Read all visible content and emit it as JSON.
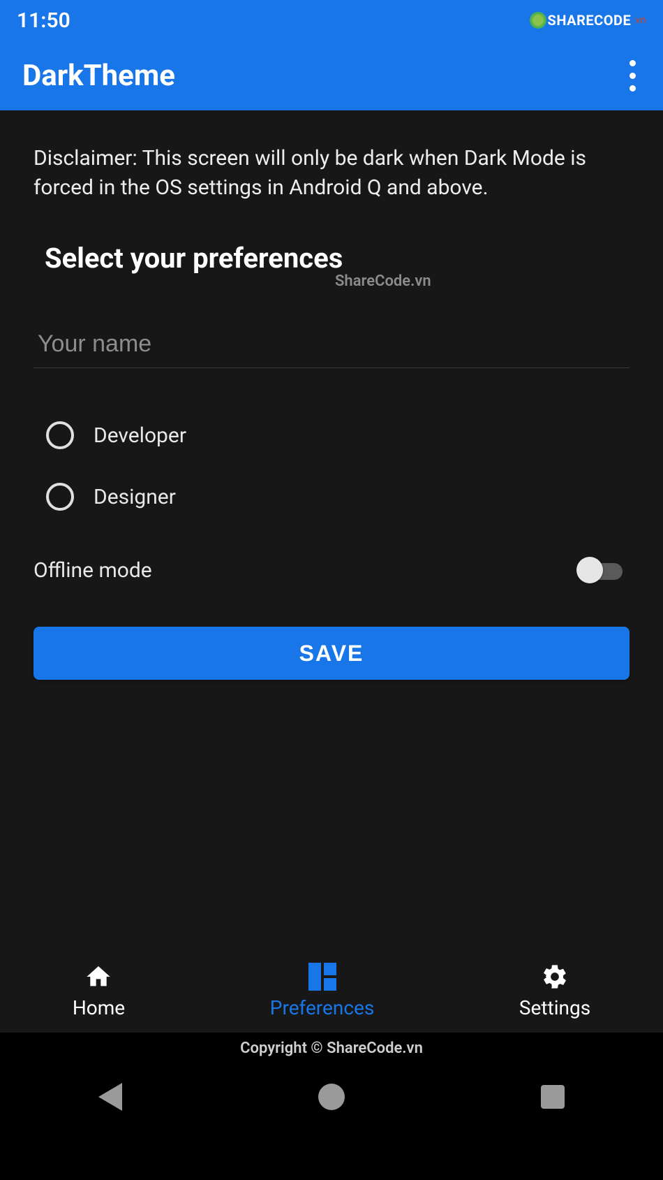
{
  "statusbar": {
    "time": "11:50",
    "brand": "SHARECODE",
    "brand_suffix": ".vn"
  },
  "appbar": {
    "title": "DarkTheme"
  },
  "content": {
    "disclaimer": "Disclaimer: This screen will only be dark when Dark Mode is forced in the OS settings in Android Q and above.",
    "heading": "Select your preferences",
    "watermark_center": "ShareCode.vn",
    "name_placeholder": "Your name",
    "name_value": "",
    "radios": [
      {
        "label": "Developer",
        "checked": false
      },
      {
        "label": "Designer",
        "checked": false
      }
    ],
    "switch_label": "Offline mode",
    "switch_on": false,
    "save_label": "SAVE"
  },
  "bottomnav": {
    "items": [
      {
        "label": "Home",
        "icon": "home-icon",
        "active": false
      },
      {
        "label": "Preferences",
        "icon": "grid-icon",
        "active": true
      },
      {
        "label": "Settings",
        "icon": "gear-icon",
        "active": false
      }
    ]
  },
  "footer": {
    "copyright": "Copyright © ShareCode.vn"
  }
}
